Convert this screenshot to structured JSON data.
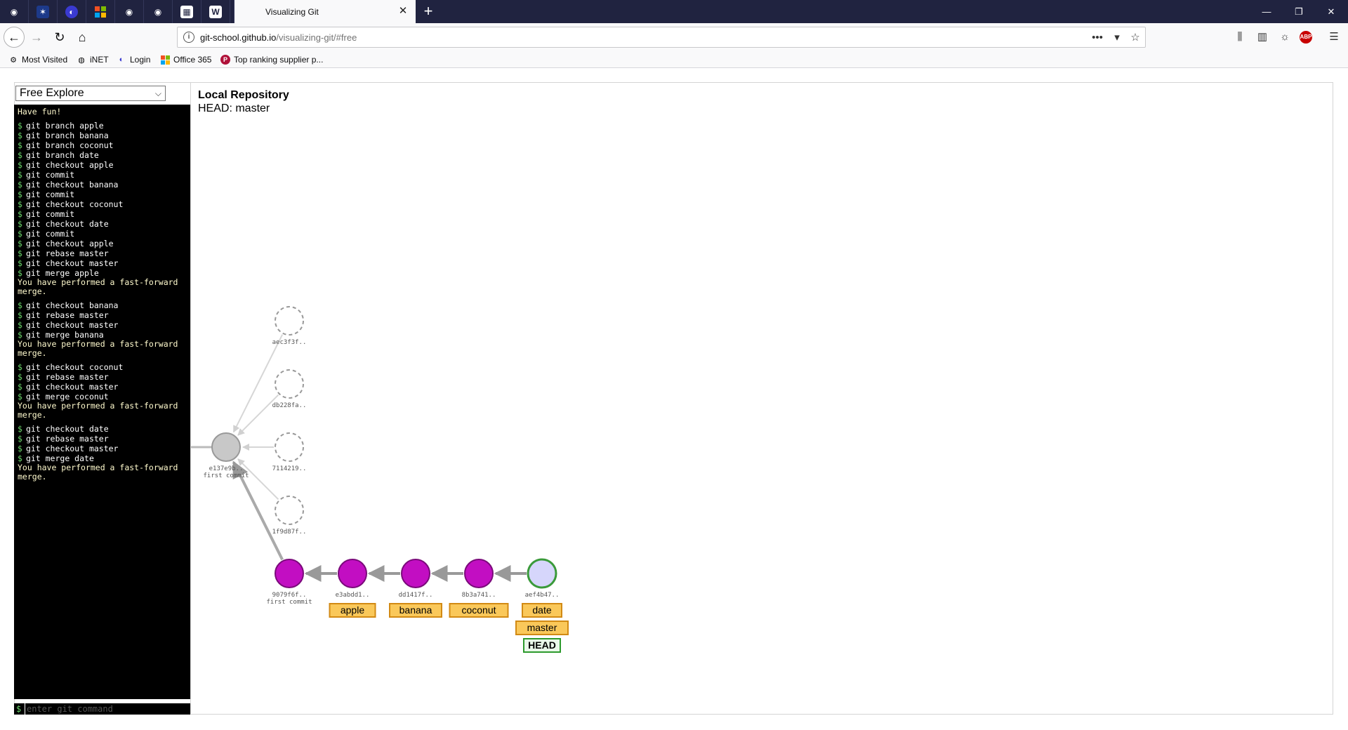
{
  "browser": {
    "active_tab_title": "Visualizing Git",
    "url_host": "git-school.github.io",
    "url_path": "/visualizing-git/#free",
    "bookmarks": [
      "Most Visited",
      "iNET",
      "Login",
      "Office 365",
      "Top ranking supplier p..."
    ],
    "pinned_tabs": [
      "github-icon",
      "star-app-icon",
      "circle-app-icon",
      "windows-icon",
      "github-icon",
      "github-icon",
      "calendar-icon",
      "w-icon",
      "red-app-icon"
    ]
  },
  "page": {
    "scenario_value": "Free Explore",
    "repo_title": "Local Repository",
    "head_label": "HEAD: master",
    "input_placeholder": "enter git command",
    "prompt_symbol": "$"
  },
  "terminal": [
    {
      "t": "info",
      "text": "Have fun!"
    },
    {
      "t": "cmd",
      "text": "git branch apple"
    },
    {
      "t": "cmd",
      "text": "git branch banana"
    },
    {
      "t": "cmd",
      "text": "git branch coconut"
    },
    {
      "t": "cmd",
      "text": "git branch date"
    },
    {
      "t": "cmd",
      "text": "git checkout apple"
    },
    {
      "t": "cmd",
      "text": "git commit"
    },
    {
      "t": "cmd",
      "text": "git checkout banana"
    },
    {
      "t": "cmd",
      "text": "git commit"
    },
    {
      "t": "cmd",
      "text": "git checkout coconut"
    },
    {
      "t": "cmd",
      "text": "git commit"
    },
    {
      "t": "cmd",
      "text": "git checkout date"
    },
    {
      "t": "cmd",
      "text": "git commit"
    },
    {
      "t": "cmd",
      "text": "git checkout apple"
    },
    {
      "t": "cmd",
      "text": "git rebase master"
    },
    {
      "t": "cmd",
      "text": "git checkout master"
    },
    {
      "t": "cmd",
      "text": "git merge apple"
    },
    {
      "t": "info",
      "text": "You have performed a fast-forward merge."
    },
    {
      "t": "cmd",
      "text": "git checkout banana"
    },
    {
      "t": "cmd",
      "text": "git rebase master"
    },
    {
      "t": "cmd",
      "text": "git checkout master"
    },
    {
      "t": "cmd",
      "text": "git merge banana"
    },
    {
      "t": "info",
      "text": "You have performed a fast-forward merge."
    },
    {
      "t": "cmd",
      "text": "git checkout coconut"
    },
    {
      "t": "cmd",
      "text": "git rebase master"
    },
    {
      "t": "cmd",
      "text": "git checkout master"
    },
    {
      "t": "cmd",
      "text": "git merge coconut"
    },
    {
      "t": "info",
      "text": "You have performed a fast-forward merge."
    },
    {
      "t": "cmd",
      "text": "git checkout date"
    },
    {
      "t": "cmd",
      "text": "git rebase master"
    },
    {
      "t": "cmd",
      "text": "git checkout master"
    },
    {
      "t": "cmd",
      "text": "git merge date"
    },
    {
      "t": "info",
      "text": "You have performed a fast-forward merge."
    }
  ],
  "graph": {
    "root": {
      "id": "e137e9b..",
      "message": "first commit"
    },
    "orphans": [
      "aec3f3f..",
      "db228fa..",
      "7114219..",
      "1f9d87f.."
    ],
    "main_line": [
      {
        "id": "9079f6f..",
        "message": "first commit",
        "branches": []
      },
      {
        "id": "e3abdd1..",
        "message": "",
        "branches": [
          "apple"
        ]
      },
      {
        "id": "dd1417f..",
        "message": "",
        "branches": [
          "banana"
        ]
      },
      {
        "id": "8b3a741..",
        "message": "",
        "branches": [
          "coconut"
        ]
      },
      {
        "id": "aef4b47..",
        "message": "",
        "branches": [
          "date",
          "master"
        ],
        "head": "HEAD"
      }
    ],
    "colors": {
      "commit_fill": "#c20ec2",
      "commit_stroke": "#7a0a7a",
      "head_fill": "#d6d6fb",
      "head_stroke": "#3a9a3a",
      "root_fill": "#c8c8c8",
      "branch_fill": "#fac85a",
      "branch_stroke": "#d28a14",
      "head_tag_fill": "#e9f8e9",
      "head_tag_stroke": "#2d9a2d"
    }
  }
}
